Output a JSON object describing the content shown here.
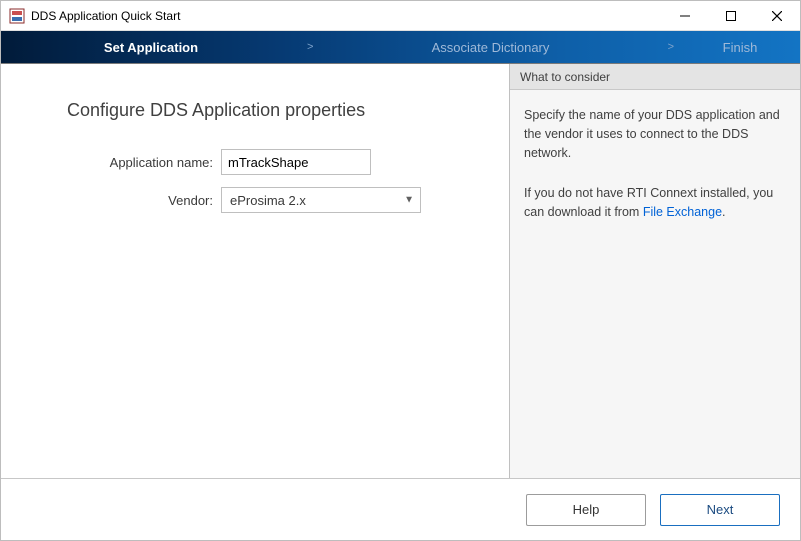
{
  "window": {
    "title": "DDS Application Quick Start"
  },
  "steps": {
    "s1": "Set Application",
    "s2": "Associate Dictionary",
    "s3": "Finish",
    "chev": ">"
  },
  "left": {
    "heading": "Configure DDS Application properties",
    "appname_label": "Application name:",
    "appname_value": "mTrackShape",
    "vendor_label": "Vendor:",
    "vendor_value": "eProsima 2.x"
  },
  "right": {
    "header": "What to consider",
    "p1": "Specify the name of your DDS application and the vendor it uses to connect to the DDS network.",
    "p2a": "If you do not have RTI Connext installed, you can download it from ",
    "p2link": "File Exchange",
    "p2b": "."
  },
  "footer": {
    "help": "Help",
    "next": "Next"
  }
}
